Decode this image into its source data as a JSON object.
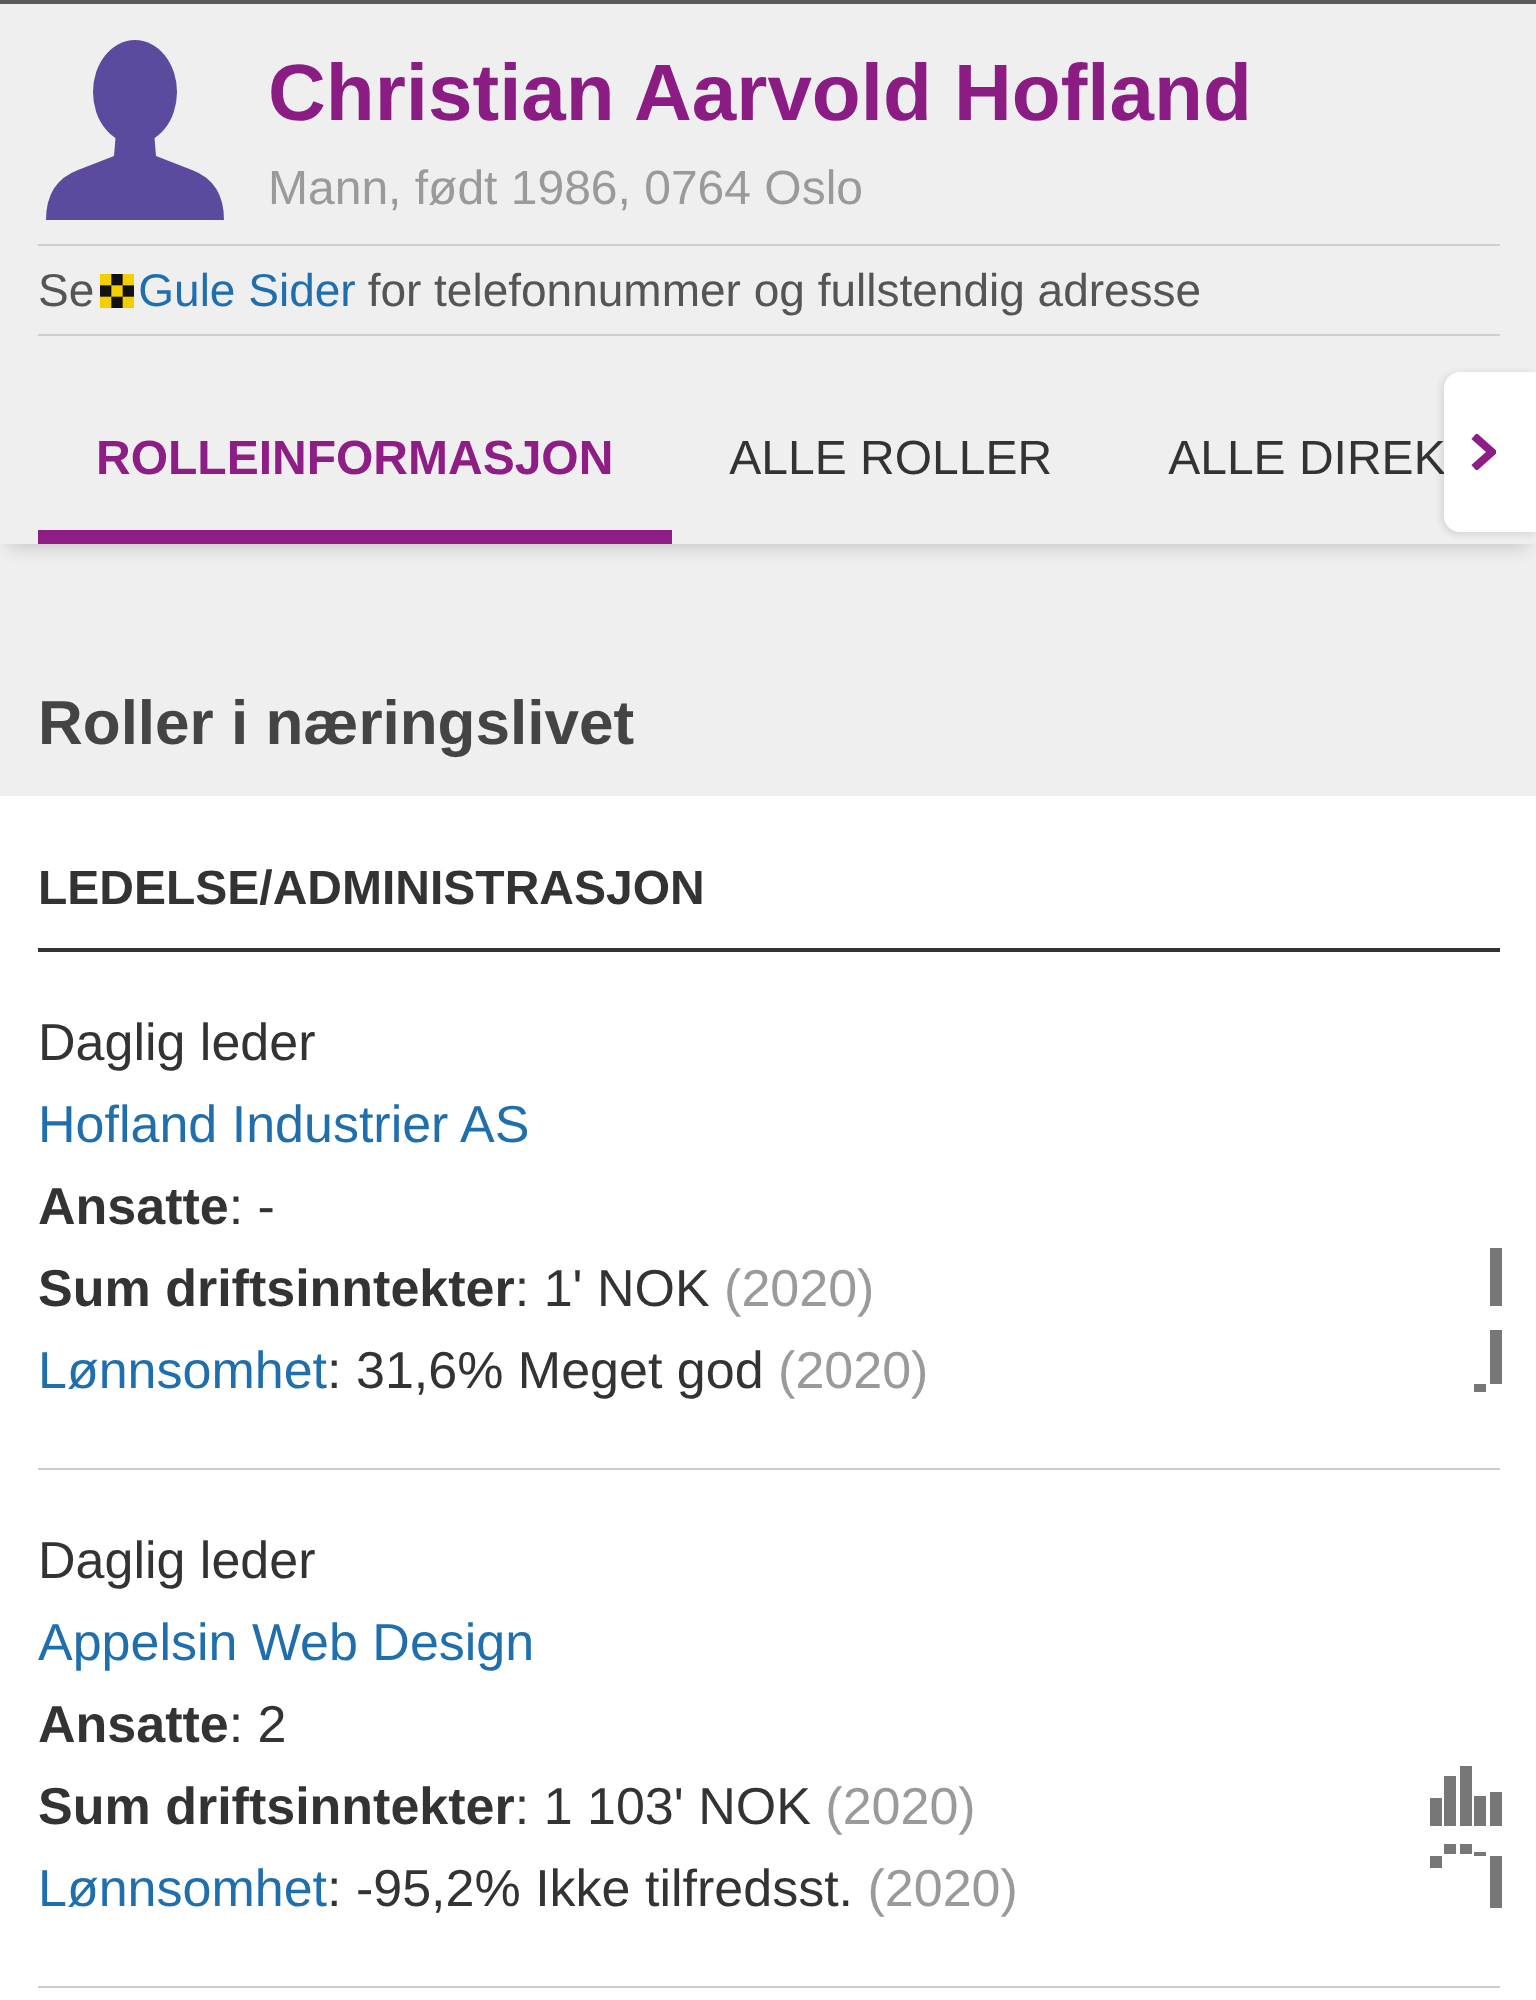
{
  "profile": {
    "name": "Christian Aarvold Hofland",
    "details": "Mann, født 1986, 0764 Oslo"
  },
  "directory_note": {
    "before": "Se",
    "link": "Gule Sider",
    "after": "for telefonnummer og fullstendig adresse"
  },
  "tabs": [
    {
      "label": "ROLLEINFORMASJON",
      "selected": true
    },
    {
      "label": "ALLE ROLLER",
      "selected": false
    },
    {
      "label": "ALLE DIREK",
      "selected": false
    }
  ],
  "section_title": "Roller i næringslivet",
  "role_group": {
    "title": "LEDELSE/ADMINISTRASJON",
    "roles": [
      {
        "position": "Daglig leder",
        "company": "Hofland Industrier AS",
        "facts": [
          {
            "kind": "text",
            "label": "Ansatte",
            "value": ": -"
          },
          {
            "kind": "text",
            "label": "Sum driftsinntekter",
            "value": ": 1' NOK",
            "year": "(2020)"
          },
          {
            "kind": "link",
            "label": "Lønnsomhet",
            "value": ": 31,6% Meget god",
            "year": "(2020)"
          }
        ]
      },
      {
        "position": "Daglig leder",
        "company": "Appelsin Web Design",
        "facts": [
          {
            "kind": "text",
            "label": "Ansatte",
            "value": ": 2"
          },
          {
            "kind": "text",
            "label": "Sum driftsinntekter",
            "value": ": 1 103' NOK",
            "year": "(2020)"
          },
          {
            "kind": "link",
            "label": "Lønnsomhet",
            "value": ": -95,2% Ikke tilfredsst.",
            "year": "(2020)"
          }
        ]
      }
    ]
  }
}
